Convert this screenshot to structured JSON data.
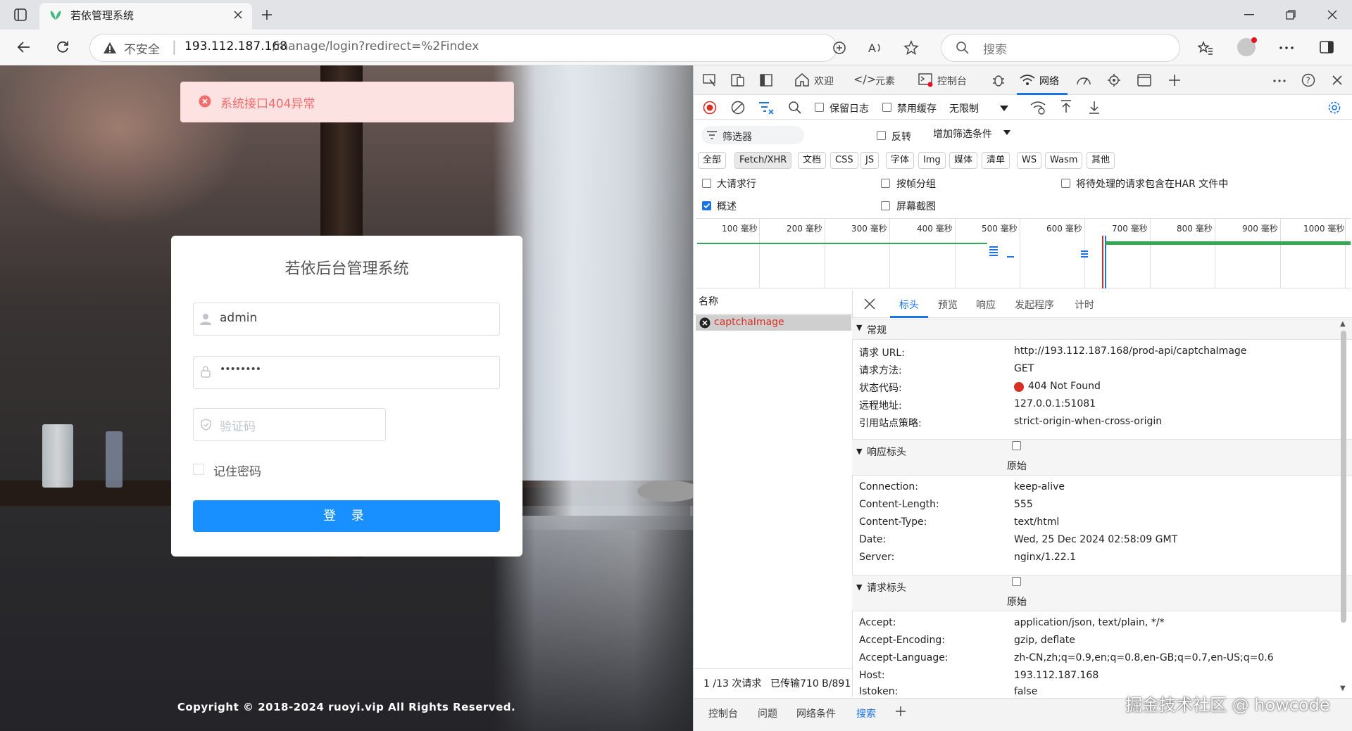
{
  "browser": {
    "tab_title": "若依管理系统",
    "security_label": "不安全",
    "url_host": "193.112.187.168",
    "url_path": "/manage/login?redirect=%2Findex",
    "search_placeholder": "搜索"
  },
  "page": {
    "toast": "系统接口404异常",
    "login_title": "若依后台管理系统",
    "username_value": "admin",
    "password_value": "••••••••",
    "captcha_placeholder": "验证码",
    "remember_label": "记住密码",
    "login_button": "登 录",
    "copyright": "Copyright © 2018-2024 ruoyi.vip All Rights Reserved."
  },
  "devtools": {
    "tabs": {
      "welcome": "欢迎",
      "elements": "元素",
      "console": "控制台",
      "network": "网络"
    },
    "toolbar": {
      "preserve_log": "保留日志",
      "disable_cache": "禁用缓存",
      "throttle": "无限制"
    },
    "filter": {
      "placeholder": "筛选器",
      "invert": "反转",
      "more_filters": "增加筛选条件"
    },
    "types": [
      "全部",
      "Fetch/XHR",
      "文档",
      "CSS",
      "JS",
      "字体",
      "Img",
      "媒体",
      "清单",
      "WS",
      "Wasm",
      "其他"
    ],
    "options": {
      "big_rows": "大请求行",
      "group_by_frame": "按帧分组",
      "har": "将待处理的请求包含在HAR 文件中",
      "overview": "概述",
      "screenshots": "屏幕截图"
    },
    "timeline_ticks": [
      "100 毫秒",
      "200 毫秒",
      "300 毫秒",
      "400 毫秒",
      "500 毫秒",
      "600 毫秒",
      "700 毫秒",
      "800 毫秒",
      "900 毫秒",
      "1000 毫秒"
    ],
    "list_header": "名称",
    "request_name": "captchaImage",
    "summary": {
      "requests": "1 /13 次请求",
      "transferred": "已传输710 B/891"
    },
    "detail_tabs": [
      "标头",
      "预览",
      "响应",
      "发起程序",
      "计时"
    ],
    "general": {
      "title": "常规",
      "rows": [
        {
          "k": "请求 URL:",
          "v": "http://193.112.187.168/prod-api/captchaImage"
        },
        {
          "k": "请求方法:",
          "v": "GET"
        },
        {
          "k": "状态代码:",
          "v": "404 Not Found"
        },
        {
          "k": "远程地址:",
          "v": "127.0.0.1:51081"
        },
        {
          "k": "引用站点策略:",
          "v": "strict-origin-when-cross-origin"
        }
      ]
    },
    "response_headers": {
      "title": "响应标头",
      "raw": "原始",
      "rows": [
        {
          "k": "Connection:",
          "v": "keep-alive"
        },
        {
          "k": "Content-Length:",
          "v": "555"
        },
        {
          "k": "Content-Type:",
          "v": "text/html"
        },
        {
          "k": "Date:",
          "v": "Wed, 25 Dec 2024 02:58:09 GMT"
        },
        {
          "k": "Server:",
          "v": "nginx/1.22.1"
        }
      ]
    },
    "request_headers": {
      "title": "请求标头",
      "raw": "原始",
      "rows": [
        {
          "k": "Accept:",
          "v": "application/json, text/plain, */*"
        },
        {
          "k": "Accept-Encoding:",
          "v": "gzip, deflate"
        },
        {
          "k": "Accept-Language:",
          "v": "zh-CN,zh;q=0.9,en;q=0.8,en-GB;q=0.7,en-US;q=0.6"
        },
        {
          "k": "Host:",
          "v": "193.112.187.168"
        },
        {
          "k": "Istoken:",
          "v": "false"
        }
      ]
    },
    "bottom_tabs": [
      "控制台",
      "问题",
      "网络条件",
      "搜索"
    ]
  },
  "watermark": "掘金技术社区 @ howcode",
  "colors": {
    "accent": "#1890ff",
    "error": "#f56c6c",
    "dt_blue": "#1a73e8"
  }
}
